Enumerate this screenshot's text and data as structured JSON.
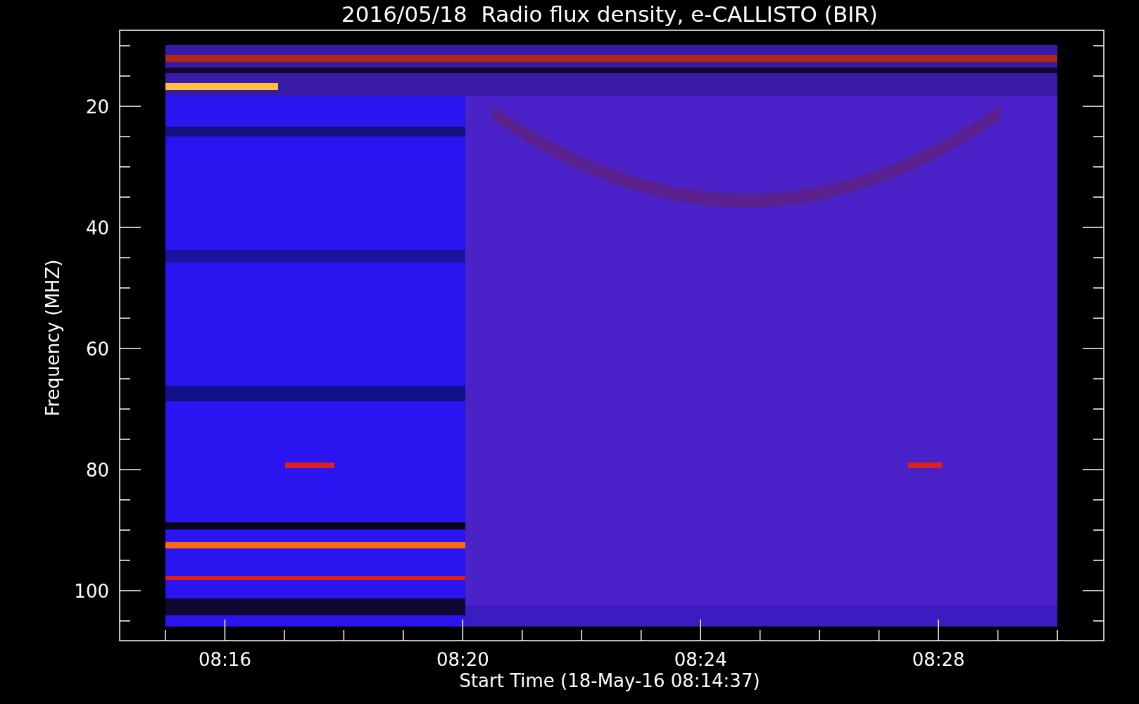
{
  "title": "2016/05/18  Radio flux density, e-CALLISTO (BIR)",
  "y_axis": {
    "label": "Frequency (MHZ)",
    "ticks": [
      "20",
      "40",
      "60",
      "80",
      "100"
    ]
  },
  "x_axis": {
    "label": "Start Time (18-May-16 08:14:37)",
    "ticks": [
      "08:16",
      "08:20",
      "08:24",
      "08:28"
    ]
  }
}
